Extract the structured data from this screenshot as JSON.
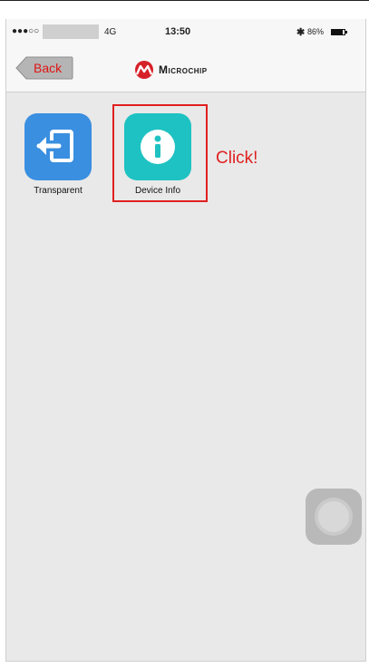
{
  "status_bar": {
    "signal": "●●●○○",
    "network": "4G",
    "time": "13:50",
    "bluetooth_icon": "bluetooth-icon",
    "battery": "86%",
    "battery_level": 0.86
  },
  "nav_bar": {
    "back_label": "Back",
    "brand": "Microchip"
  },
  "apps": [
    {
      "label": "Transparent",
      "color": "#3a8fe0",
      "icon": "transfer-in-icon"
    },
    {
      "label": "Device Info",
      "color": "#1fc2c2",
      "icon": "info-icon"
    }
  ],
  "annotation": {
    "text": "Click!",
    "color": "#e02020"
  },
  "colors": {
    "back_text": "#e01414",
    "brand_red": "#d62028",
    "background": "#e9e9e9"
  }
}
